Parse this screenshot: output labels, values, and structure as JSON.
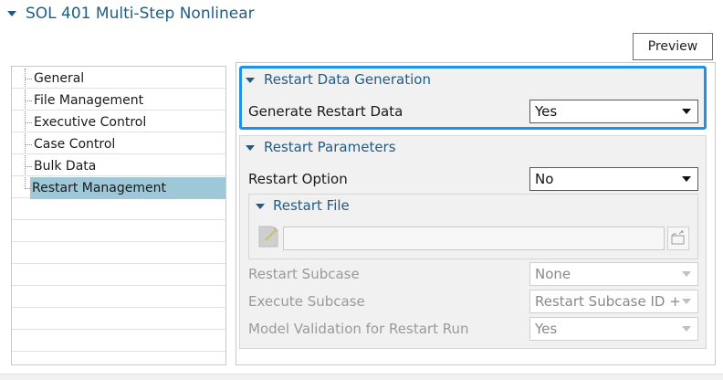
{
  "header": {
    "title": "SOL 401 Multi-Step Nonlinear",
    "collapse_icon": "triangle-down-icon"
  },
  "toolbar": {
    "preview_label": "Preview"
  },
  "tree": {
    "items": [
      {
        "label": "General",
        "selected": false
      },
      {
        "label": "File Management",
        "selected": false
      },
      {
        "label": "Executive Control",
        "selected": false
      },
      {
        "label": "Case Control",
        "selected": false
      },
      {
        "label": "Bulk Data",
        "selected": false
      },
      {
        "label": "Restart Management",
        "selected": true
      }
    ]
  },
  "restart_data_generation": {
    "title": "Restart Data Generation",
    "generate_label": "Generate Restart Data",
    "generate_value": "Yes"
  },
  "restart_parameters": {
    "title": "Restart Parameters",
    "option_label": "Restart Option",
    "option_value": "No",
    "restart_file": {
      "title": "Restart File",
      "path_value": "",
      "file_icon": "edit-file-icon",
      "browse_icon": "open-folder-icon"
    },
    "subcase_label": "Restart Subcase",
    "subcase_value": "None",
    "execute_label": "Execute Subcase",
    "execute_value": "Restart Subcase ID +",
    "validation_label": "Model Validation for Restart Run",
    "validation_value": "Yes"
  },
  "colors": {
    "accent_blue": "#1e90ee",
    "title_blue": "#1f5d87",
    "selection": "#9ec8d8",
    "disabled_text": "#9a9a9a"
  }
}
